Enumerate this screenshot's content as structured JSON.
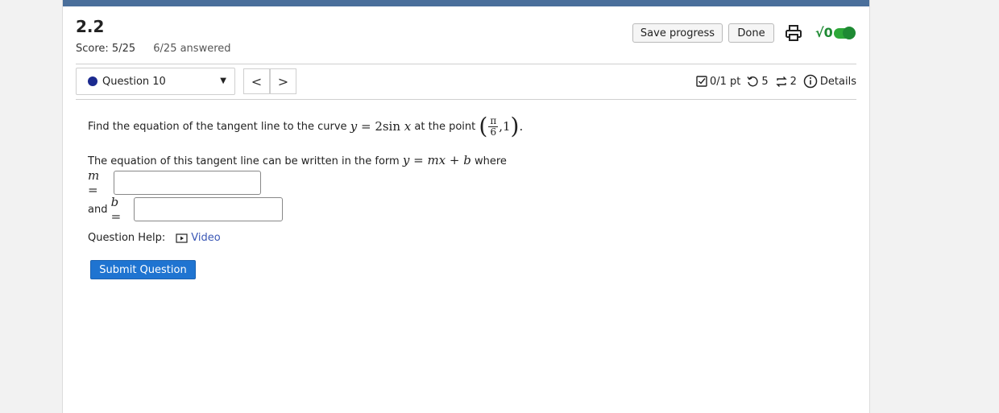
{
  "header": {
    "assignment_title": "2.2",
    "score": "Score: 5/25",
    "answered": "6/25 answered",
    "save_label": "Save progress",
    "done_label": "Done"
  },
  "question_nav": {
    "selected": "Question 10",
    "prev_label": "<",
    "next_label": ">"
  },
  "meta": {
    "points": "0/1 pt",
    "retries": "5",
    "submissions": "2",
    "details_label": "Details"
  },
  "question": {
    "intro": "Find the equation of the tangent line to the curve",
    "curve_lhs": "y",
    "curve_eq": "=",
    "curve_coef": "2",
    "curve_fn": "sin",
    "curve_var": "x",
    "point_intro": "at the point",
    "point_num": "π",
    "point_den": "6",
    "point_y": "1",
    "form_text": "The equation of this tangent line can be written in the form",
    "form_eq": "y = mx + b",
    "form_where": "where",
    "m_label": "m =",
    "b_prefix": "and",
    "b_label": "b =",
    "m_value": "",
    "b_value": ""
  },
  "help": {
    "label": "Question Help:",
    "video_label": "Video"
  },
  "submit_label": "Submit Question",
  "colors": {
    "accent": "#1f74d1",
    "top_strip": "#4a6f9b",
    "toggle": "#2da838",
    "link": "#3a57b5"
  }
}
